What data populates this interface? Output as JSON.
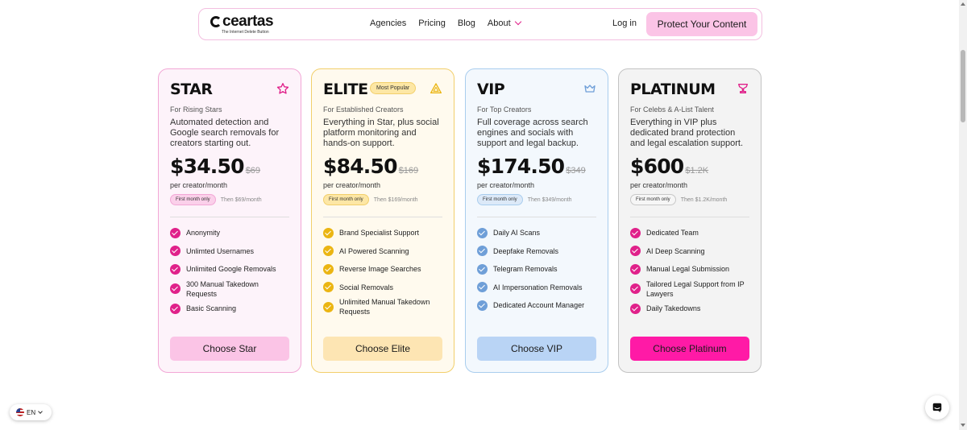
{
  "nav": {
    "logo_text": "ceartas",
    "logo_tagline": "The Internet Delete Button",
    "links": [
      "Agencies",
      "Pricing",
      "Blog",
      "About"
    ],
    "login": "Log in",
    "cta": "Protect Your Content"
  },
  "plans": [
    {
      "tier": "STAR",
      "icon": "star-icon",
      "badge": "",
      "subtitle": "For Rising Stars",
      "description": "Automated detection and Google search removals for creators starting out.",
      "price": "$34.50",
      "old_price": "$69",
      "per": "per creator/month",
      "promo": "First month only",
      "then": "Then $69/month",
      "features": [
        "Anonymity",
        "Unlimted Usernames",
        "Unlimited Google Removals",
        "300 Manual Takedown Requests",
        "Basic Scanning"
      ],
      "button": "Choose Star"
    },
    {
      "tier": "ELITE",
      "icon": "triangle-icon",
      "badge": "Most Popular",
      "subtitle": "For Established Creators",
      "description": "Everything in Star, plus social platform monitoring and hands-on support.",
      "price": "$84.50",
      "old_price": "$169",
      "per": "per creator/month",
      "promo": "First month only",
      "then": "Then $169/month",
      "features": [
        "Brand Specialist Support",
        "AI Powered Scanning",
        "Reverse Image Searches",
        "Social Removals",
        "Unlimited Manual Takedown Requests"
      ],
      "button": "Choose Elite"
    },
    {
      "tier": "VIP",
      "icon": "crown-icon",
      "badge": "",
      "subtitle": "For Top Creators",
      "description": "Full coverage across search engines and socials with support and legal backup.",
      "price": "$174.50",
      "old_price": "$349",
      "per": "per creator/month",
      "promo": "First month only",
      "then": "Then $349/month",
      "features": [
        "Daily AI Scans",
        "Deepfake Removals",
        "Telegram Removals",
        "AI Impersonation Removals",
        "Dedicated Account Manager"
      ],
      "button": "Choose VIP"
    },
    {
      "tier": "PLATINUM",
      "icon": "trophy-icon",
      "badge": "",
      "subtitle": "For Celebs & A-List Talent",
      "description": "Everything in VIP plus dedicated brand protection and legal escalation support.",
      "price": "$600",
      "old_price": "$1.2K",
      "per": "per creator/month",
      "promo": "First month only",
      "then": "Then $1.2K/month",
      "features": [
        "Dedicated Team",
        "AI Deep Scanning",
        "Manual Legal Submission",
        "Tailored Legal Support from IP Lawyers",
        "Daily Takedowns"
      ],
      "button": "Choose Platinum"
    }
  ],
  "lang": {
    "code": "EN"
  },
  "colors": {
    "accent": "#e0218a",
    "elite": "#ebb512",
    "vip": "#6f9fd8"
  }
}
